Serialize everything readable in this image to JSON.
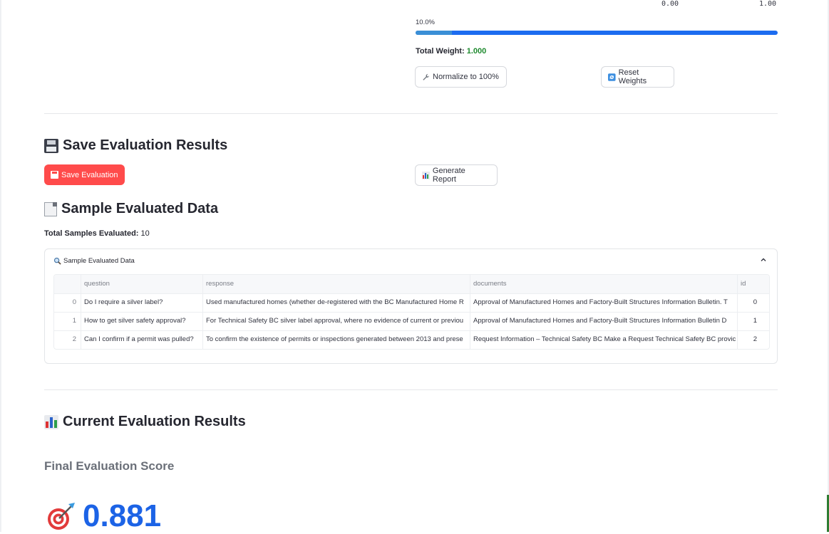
{
  "slider": {
    "min_label": "0.00",
    "max_label": "1.00",
    "value_label": "10.0%",
    "value_fraction": 0.1
  },
  "weights": {
    "total_label": "Total Weight:",
    "total_value": "1.000",
    "normalize_button": "Normalize to 100%",
    "reset_button": "Reset Weights"
  },
  "save_section": {
    "heading": "Save Evaluation Results",
    "save_button": "Save Evaluation",
    "generate_button": "Generate Report"
  },
  "sample_section": {
    "heading": "Sample Evaluated Data",
    "total_label": "Total Samples Evaluated:",
    "total_value": "10",
    "expander_label": "Sample Evaluated Data",
    "table": {
      "columns": [
        "",
        "question",
        "response",
        "documents",
        "id"
      ],
      "rows": [
        {
          "index": "0",
          "question": "Do I require a silver label?",
          "response": "Used manufactured homes (whether de-registered with the BC Manufactured Home R",
          "documents": "Approval of Manufactured Homes and Factory-Built Structures Information Bulletin. T",
          "id": "0"
        },
        {
          "index": "1",
          "question": "How to get silver safety approval?",
          "response": "For Technical Safety BC silver label approval, where no evidence of current or previou",
          "documents": "Approval of Manufactured Homes and Factory-Built Structures Information Bulletin D",
          "id": "1"
        },
        {
          "index": "2",
          "question": "Can I confirm if a permit was pulled?",
          "response": "To confirm the existence of permits or inspections generated between 2013 and prese",
          "documents": "Request Information – Technical Safety BC Make a Request Technical Safety BC provic",
          "id": "2"
        }
      ]
    }
  },
  "results_section": {
    "heading": "Current Evaluation Results",
    "final_label": "Final Evaluation Score",
    "score": "0.881"
  },
  "colors": {
    "primary_button": "#ff4b4b",
    "slider": "#1c6cf0",
    "score": "#1c63e6",
    "total_value": "#1e8a2e"
  },
  "icons": {
    "normalize": "wrench-icon",
    "reset": "refresh-icon",
    "save": "floppy-disk-icon",
    "generate": "bar-chart-icon",
    "sample": "document-icon",
    "expander": "magnifier-icon",
    "expander_toggle": "chevron-up-icon",
    "score": "target-icon"
  }
}
